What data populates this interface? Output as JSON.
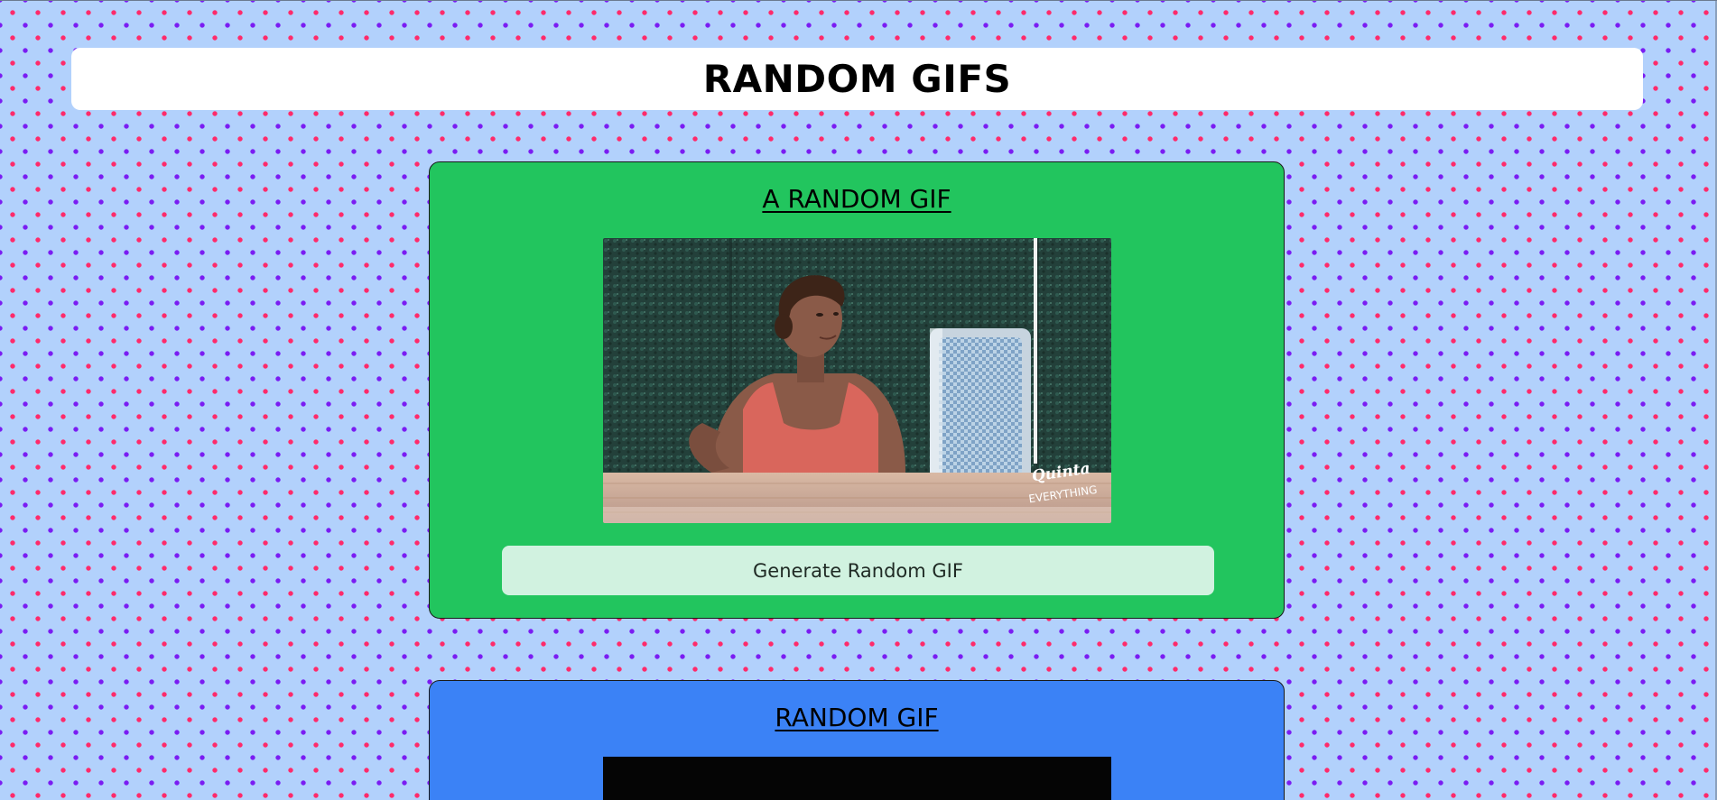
{
  "page": {
    "title": "RANDOM GIFS"
  },
  "cards": [
    {
      "title": "A RANDOM GIF",
      "color": "#22c55e",
      "gif": {
        "watermark_line1": "Quinta",
        "watermark_line2": "EVERYTHING"
      },
      "button_label": "Generate Random GIF"
    },
    {
      "title": "RANDOM GIF",
      "color": "#3b82f6"
    }
  ],
  "colors": {
    "background": "#b2d1fc",
    "dot_pink": "#ff2a6a",
    "dot_purple": "#7a1cf2",
    "button_bg": "#d1f2e0"
  }
}
